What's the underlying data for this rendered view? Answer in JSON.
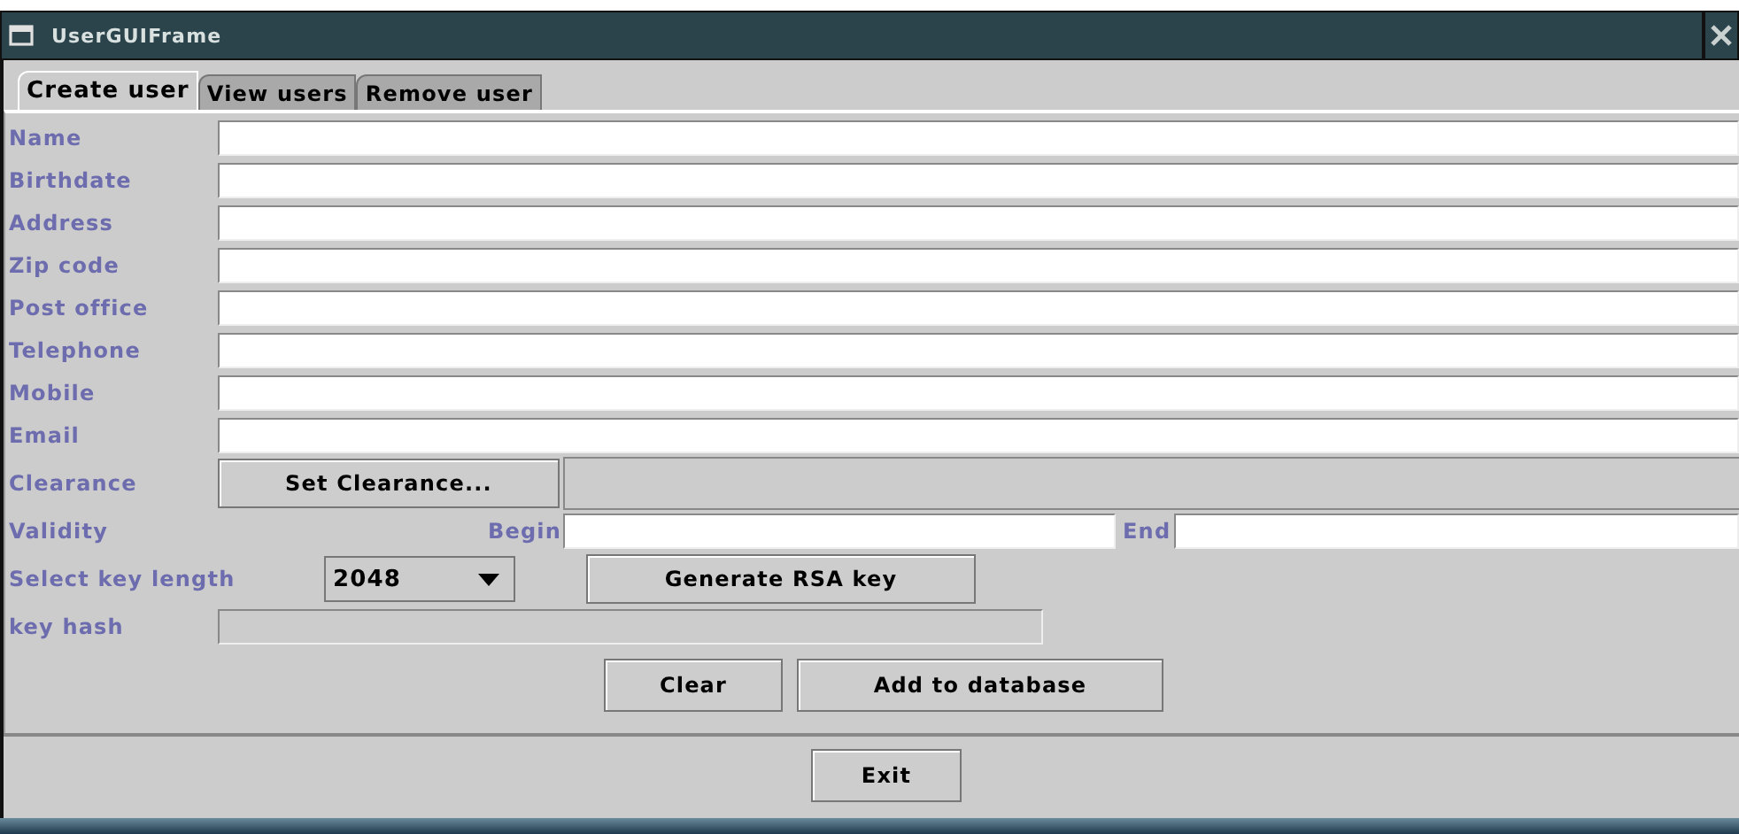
{
  "window": {
    "title": "UserGUIFrame"
  },
  "tabs": [
    {
      "label": "Create user",
      "selected": true
    },
    {
      "label": "View users",
      "selected": false
    },
    {
      "label": "Remove user",
      "selected": false
    }
  ],
  "fields": [
    {
      "label": "Name"
    },
    {
      "label": "Birthdate"
    },
    {
      "label": "Address"
    },
    {
      "label": "Zip code"
    },
    {
      "label": "Post office"
    },
    {
      "label": "Telephone"
    },
    {
      "label": "Mobile"
    },
    {
      "label": "Email"
    }
  ],
  "clearance": {
    "label": "Clearance",
    "button": "Set Clearance..."
  },
  "validity": {
    "label": "Validity",
    "begin_label": "Begin",
    "end_label": "End"
  },
  "key_length": {
    "label": "Select key length",
    "value": "2048",
    "button": "Generate RSA key"
  },
  "key_hash": {
    "label": "key hash",
    "disabled": true
  },
  "actions": [
    "Clear",
    "Add to database"
  ],
  "exit_button": "Exit"
}
